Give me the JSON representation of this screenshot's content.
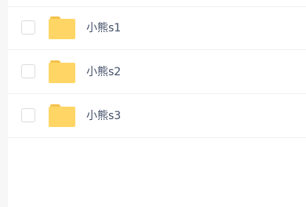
{
  "files": [
    {
      "name": "小熊s1",
      "icon": "folder-icon",
      "checked": false
    },
    {
      "name": "小熊s2",
      "icon": "folder-icon",
      "checked": false
    },
    {
      "name": "小熊s3",
      "icon": "folder-icon",
      "checked": false
    }
  ],
  "colors": {
    "folder_body": "#ffd666",
    "folder_tab": "#f5c24c",
    "text": "#424e67",
    "divider": "#f0f0f0",
    "checkbox_border": "#dcdcdc",
    "gutter": "#f7f7f8"
  }
}
